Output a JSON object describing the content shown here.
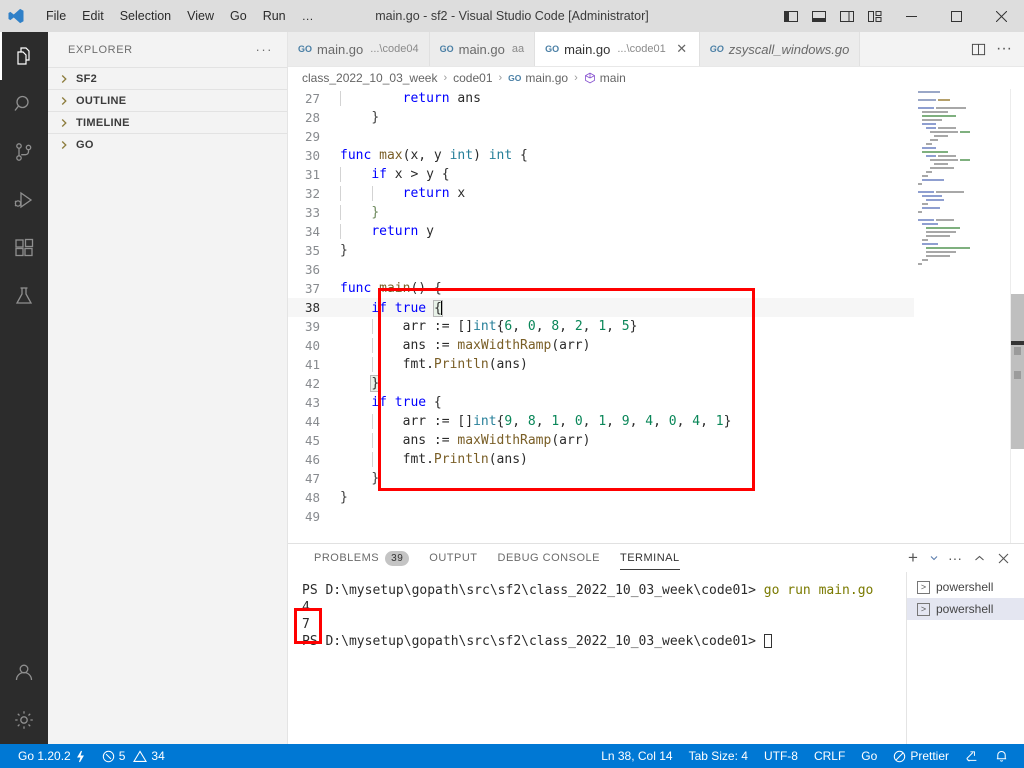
{
  "window": {
    "title": "main.go - sf2 - Visual Studio Code [Administrator]",
    "menu": [
      "File",
      "Edit",
      "Selection",
      "View",
      "Go",
      "Run"
    ],
    "menu_more": "…",
    "controls": {
      "toggle_primary_sidebar": "toggle-primary-sidebar",
      "toggle_panel": "toggle-panel",
      "toggle_secondary_sidebar": "toggle-secondary-sidebar",
      "customize_layout": "customize-layout",
      "minimize": "–",
      "maximize": "□",
      "close": "✕"
    }
  },
  "activitybar": {
    "items": [
      {
        "name": "explorer",
        "icon": "files-icon",
        "active": true
      },
      {
        "name": "search",
        "icon": "search-icon",
        "active": false
      },
      {
        "name": "source-control",
        "icon": "source-control-icon",
        "active": false
      },
      {
        "name": "run-and-debug",
        "icon": "run-debug-icon",
        "active": false
      },
      {
        "name": "extensions",
        "icon": "extensions-icon",
        "active": false
      },
      {
        "name": "testing",
        "icon": "beaker-icon",
        "active": false
      }
    ],
    "bottom": [
      {
        "name": "accounts",
        "icon": "account-icon"
      },
      {
        "name": "manage",
        "icon": "gear-icon"
      }
    ]
  },
  "sidebar": {
    "title": "EXPLORER",
    "more_label": "···",
    "sections": [
      {
        "label": "SF2",
        "expanded": false
      },
      {
        "label": "OUTLINE",
        "expanded": false
      },
      {
        "label": "TIMELINE",
        "expanded": false
      },
      {
        "label": "GO",
        "expanded": false
      }
    ]
  },
  "tabs": [
    {
      "icon": "go-file-icon",
      "label": "main.go",
      "sub": "...\\code04",
      "active": false,
      "italic": false,
      "closable": false
    },
    {
      "icon": "go-file-icon",
      "label": "main.go",
      "sub": "aa",
      "active": false,
      "italic": false,
      "closable": false
    },
    {
      "icon": "go-file-icon",
      "label": "main.go",
      "sub": "...\\code01",
      "active": true,
      "italic": false,
      "closable": true,
      "close_label": "✕"
    },
    {
      "icon": "go-file-icon",
      "label": "zsyscall_windows.go",
      "sub": "",
      "active": false,
      "italic": true,
      "closable": false
    }
  ],
  "tabbar_actions": [
    {
      "name": "split-editor-right",
      "icon": "split-editor-icon"
    },
    {
      "name": "more-editor-actions",
      "icon": "ellipsis-icon",
      "glyph": "···"
    }
  ],
  "breadcrumb": [
    {
      "label": "class_2022_10_03_week",
      "icon": ""
    },
    {
      "label": "code01",
      "icon": ""
    },
    {
      "label": "main.go",
      "icon": "go-file-icon"
    },
    {
      "label": "main",
      "icon": "symbol-method-icon"
    }
  ],
  "editor": {
    "first_line": 27,
    "current_line": 38,
    "lines": [
      {
        "n": 27,
        "text": "        return ans",
        "indent_guides": [
          1
        ]
      },
      {
        "n": 28,
        "text": "    }",
        "indent_guides": []
      },
      {
        "n": 29,
        "text": "",
        "indent_guides": []
      },
      {
        "n": 30,
        "text": "func max(x, y int) int {",
        "indent_guides": []
      },
      {
        "n": 31,
        "text": "    if x > y {",
        "indent_guides": [
          1
        ]
      },
      {
        "n": 32,
        "text": "        return x",
        "indent_guides": [
          1,
          2
        ]
      },
      {
        "n": 33,
        "text": "    }",
        "indent_guides": [
          1
        ]
      },
      {
        "n": 34,
        "text": "    return y",
        "indent_guides": [
          1
        ]
      },
      {
        "n": 35,
        "text": "}",
        "indent_guides": []
      },
      {
        "n": 36,
        "text": "",
        "indent_guides": []
      },
      {
        "n": 37,
        "text": "func main() {",
        "indent_guides": []
      },
      {
        "n": 38,
        "text": "    if true {",
        "indent_guides": [
          1
        ]
      },
      {
        "n": 39,
        "text": "        arr := []int{6, 0, 8, 2, 1, 5}",
        "indent_guides": [
          1,
          2
        ]
      },
      {
        "n": 40,
        "text": "        ans := maxWidthRamp(arr)",
        "indent_guides": [
          1,
          2
        ]
      },
      {
        "n": 41,
        "text": "        fmt.Println(ans)",
        "indent_guides": [
          1,
          2
        ]
      },
      {
        "n": 42,
        "text": "    }",
        "indent_guides": [
          1
        ]
      },
      {
        "n": 43,
        "text": "    if true {",
        "indent_guides": [
          1
        ]
      },
      {
        "n": 44,
        "text": "        arr := []int{9, 8, 1, 0, 1, 9, 4, 0, 4, 1}",
        "indent_guides": [
          1,
          2
        ]
      },
      {
        "n": 45,
        "text": "        ans := maxWidthRamp(arr)",
        "indent_guides": [
          1,
          2
        ]
      },
      {
        "n": 46,
        "text": "        fmt.Println(ans)",
        "indent_guides": [
          1,
          2
        ]
      },
      {
        "n": 47,
        "text": "    }",
        "indent_guides": [
          1
        ]
      },
      {
        "n": 48,
        "text": "}",
        "indent_guides": []
      },
      {
        "n": 49,
        "text": "",
        "indent_guides": []
      }
    ],
    "annotation_color": "#ff0000"
  },
  "panel": {
    "tabs": [
      {
        "label": "PROBLEMS",
        "badge": "39",
        "active": false
      },
      {
        "label": "OUTPUT",
        "badge": "",
        "active": false
      },
      {
        "label": "DEBUG CONSOLE",
        "badge": "",
        "active": false
      },
      {
        "label": "TERMINAL",
        "badge": "",
        "active": true
      }
    ],
    "actions": [
      {
        "name": "new-terminal",
        "glyph": "+"
      },
      {
        "name": "terminal-dropdown",
        "glyph": "⌄"
      },
      {
        "name": "panel-more-actions",
        "glyph": "···"
      },
      {
        "name": "maximize-panel",
        "glyph": "⌃"
      },
      {
        "name": "close-panel",
        "glyph": "✕"
      }
    ],
    "terminal": {
      "lines": [
        {
          "type": "prompt",
          "prompt": "PS D:\\mysetup\\gopath\\src\\sf2\\class_2022_10_03_week\\code01>",
          "command": " go run main.go"
        },
        {
          "type": "output",
          "text": "4"
        },
        {
          "type": "output",
          "text": "7"
        },
        {
          "type": "prompt",
          "prompt": "PS D:\\mysetup\\gopath\\src\\sf2\\class_2022_10_03_week\\code01>",
          "command": "",
          "cursor": true
        }
      ],
      "instances": [
        {
          "label": "powershell",
          "icon": "powershell-icon",
          "selected": false
        },
        {
          "label": "powershell",
          "icon": "powershell-icon",
          "selected": true
        }
      ]
    }
  },
  "statusbar": {
    "background": "#0078d4",
    "left": [
      {
        "name": "go-version",
        "label": "Go 1.20.2",
        "icon": "lightning-icon"
      },
      {
        "name": "problems",
        "label": "5",
        "label2": "34",
        "icon": "error-icon",
        "icon2": "warning-icon"
      }
    ],
    "right": [
      {
        "name": "editor-position",
        "label": "Ln 38, Col 14"
      },
      {
        "name": "indentation",
        "label": "Tab Size: 4"
      },
      {
        "name": "encoding",
        "label": "UTF-8"
      },
      {
        "name": "eol",
        "label": "CRLF"
      },
      {
        "name": "language-mode",
        "label": "Go"
      },
      {
        "name": "prettier",
        "label": "Prettier",
        "icon": "prohibited-icon"
      },
      {
        "name": "remote-host",
        "label": "",
        "icon": "remote-icon"
      },
      {
        "name": "notifications",
        "label": "",
        "icon": "bell-icon"
      }
    ]
  }
}
